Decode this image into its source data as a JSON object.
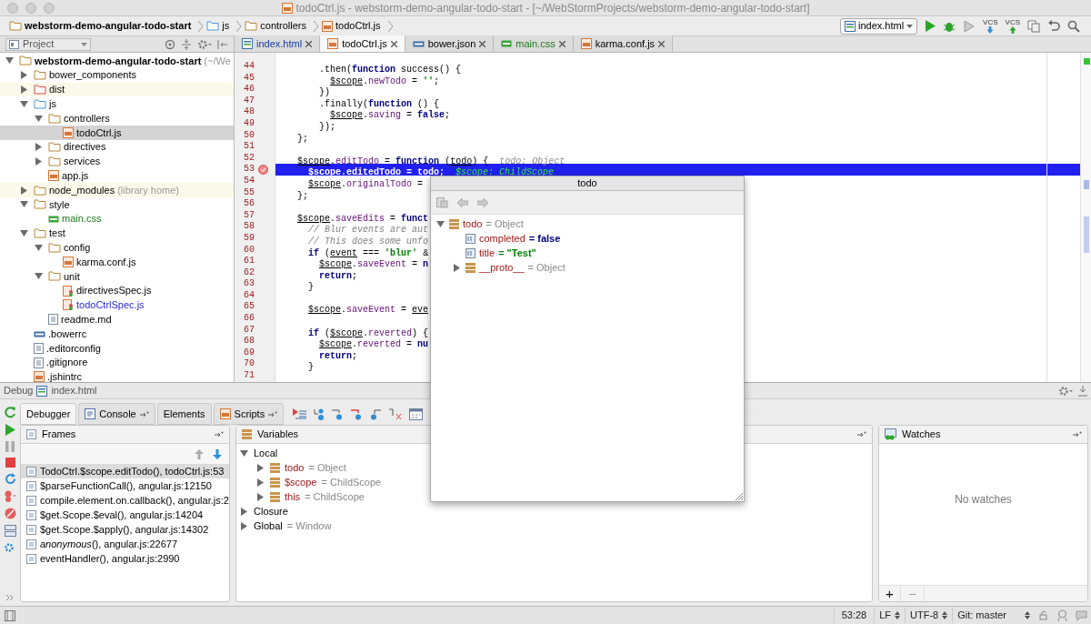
{
  "window": {
    "title": "todoCtrl.js - webstorm-demo-angular-todo-start - [~/WebStormProjects/webstorm-demo-angular-todo-start]"
  },
  "breadcrumbs": [
    {
      "label": "webstorm-demo-angular-todo-start",
      "kind": "folder"
    },
    {
      "label": "js",
      "kind": "source-folder"
    },
    {
      "label": "controllers",
      "kind": "folder"
    },
    {
      "label": "todoCtrl.js",
      "kind": "js"
    }
  ],
  "run_config": {
    "label": "index.html"
  },
  "toolbar": [
    {
      "kind": "run"
    },
    {
      "kind": "debug"
    },
    {
      "kind": "coverage"
    },
    {
      "kind": "vcs-update",
      "label": "VCS"
    },
    {
      "kind": "vcs-commit",
      "label": "VCS"
    },
    {
      "kind": "compare"
    },
    {
      "kind": "undo"
    },
    {
      "kind": "search"
    }
  ],
  "project_panel": {
    "title": "Project"
  },
  "tabs": [
    {
      "label": "index.html",
      "kind": "html",
      "color": "#1a3ca8",
      "selected": false
    },
    {
      "label": "todoCtrl.js",
      "kind": "js",
      "selected": true
    },
    {
      "label": "bower.json",
      "kind": "json",
      "selected": false
    },
    {
      "label": "main.css",
      "kind": "css",
      "color": "#1b7a1b",
      "selected": false
    },
    {
      "label": "karma.conf.js",
      "kind": "js",
      "selected": false
    }
  ],
  "tree": [
    {
      "label": "webstorm-demo-angular-todo-start",
      "note": "(~/We",
      "kind": "folder",
      "expanded": true,
      "children": [
        {
          "label": "bower_components",
          "kind": "folder",
          "expanded": false
        },
        {
          "label": "dist",
          "kind": "excluded-folder",
          "expanded": false,
          "highlighted": true
        },
        {
          "label": "js",
          "kind": "source-folder",
          "expanded": true,
          "children": [
            {
              "label": "controllers",
              "kind": "folder",
              "expanded": true,
              "children": [
                {
                  "label": "todoCtrl.js",
                  "kind": "js",
                  "selected": true
                }
              ]
            },
            {
              "label": "directives",
              "kind": "folder",
              "expanded": false
            },
            {
              "label": "services",
              "kind": "folder",
              "expanded": false
            },
            {
              "label": "app.js",
              "kind": "js",
              "selected": false
            }
          ]
        },
        {
          "label": "node_modules",
          "note": "(library home)",
          "kind": "folder",
          "expanded": false,
          "highlighted": true
        },
        {
          "label": "style",
          "kind": "folder",
          "expanded": true,
          "children": [
            {
              "label": "main.css",
              "kind": "css",
              "color": "#1b7a1b",
              "selected": false
            }
          ]
        },
        {
          "label": "test",
          "kind": "folder",
          "expanded": true,
          "children": [
            {
              "label": "config",
              "kind": "folder",
              "expanded": true,
              "children": [
                {
                  "label": "karma.conf.js",
                  "kind": "js",
                  "selected": false
                }
              ]
            },
            {
              "label": "unit",
              "kind": "folder",
              "expanded": true,
              "children": [
                {
                  "label": "directivesSpec.js",
                  "kind": "test-js",
                  "selected": false
                },
                {
                  "label": "todoCtrlSpec.js",
                  "kind": "test-js",
                  "modified": true,
                  "selected": false
                }
              ]
            },
            {
              "label": "readme.md",
              "kind": "text",
              "selected": false
            }
          ]
        },
        {
          "label": ".bowerrc",
          "kind": "json",
          "selected": false
        },
        {
          "label": ".editorconfig",
          "kind": "text",
          "selected": false
        },
        {
          "label": ".gitignore",
          "kind": "text",
          "selected": false
        },
        {
          "label": ".jshintrc",
          "kind": "js",
          "selected": false
        }
      ]
    }
  ],
  "editor": {
    "lines": [
      {
        "number": "44",
        "tokens": [
          {
            "text": "        .then(",
            "kind": "plain"
          },
          {
            "text": "function",
            "kind": "kw"
          },
          {
            "text": " success() {",
            "kind": "plain"
          }
        ]
      },
      {
        "number": "45",
        "tokens": [
          {
            "text": "          $scope",
            "kind": "var"
          },
          {
            "text": ".",
            "kind": "plain"
          },
          {
            "text": "newTodo",
            "kind": "prop"
          },
          {
            "text": " = ",
            "kind": "plain"
          },
          {
            "text": "''",
            "kind": "str"
          },
          {
            "text": ";",
            "kind": "plain"
          }
        ]
      },
      {
        "number": "46",
        "tokens": [
          {
            "text": "        })",
            "kind": "plain"
          }
        ]
      },
      {
        "number": "47",
        "tokens": [
          {
            "text": "        .finally(",
            "kind": "plain"
          },
          {
            "text": "function",
            "kind": "kw"
          },
          {
            "text": " () {",
            "kind": "plain"
          }
        ]
      },
      {
        "number": "48",
        "tokens": [
          {
            "text": "          $scope",
            "kind": "var"
          },
          {
            "text": ".",
            "kind": "plain"
          },
          {
            "text": "saving",
            "kind": "prop"
          },
          {
            "text": " = ",
            "kind": "plain"
          },
          {
            "text": "false",
            "kind": "kw"
          },
          {
            "text": ";",
            "kind": "plain"
          }
        ]
      },
      {
        "number": "49",
        "tokens": [
          {
            "text": "        });",
            "kind": "plain"
          }
        ]
      },
      {
        "number": "50",
        "tokens": [
          {
            "text": "    };",
            "kind": "plain"
          }
        ]
      },
      {
        "number": "51"
      },
      {
        "number": "52",
        "tokens": [
          {
            "text": "    $scope",
            "kind": "var"
          },
          {
            "text": ".",
            "kind": "plain"
          },
          {
            "text": "editTodo",
            "kind": "prop"
          },
          {
            "text": " = ",
            "kind": "plain"
          },
          {
            "text": "function",
            "kind": "kw"
          },
          {
            "text": " (",
            "kind": "plain"
          },
          {
            "text": "todo",
            "kind": "var"
          },
          {
            "text": ") {",
            "kind": "plain"
          },
          {
            "text": "  todo: Object",
            "kind": "hint"
          }
        ]
      },
      {
        "number": "53",
        "current": true,
        "breakpoint": true,
        "tokens": [
          {
            "text": "      $scope.editedTodo = todo;",
            "kind": "plain"
          },
          {
            "text": "  $scope: ChildScope",
            "kind": "hint"
          }
        ]
      },
      {
        "number": "54",
        "tokens": [
          {
            "text": "      $scope",
            "kind": "var"
          },
          {
            "text": ".",
            "kind": "plain"
          },
          {
            "text": "originalTodo",
            "kind": "prop"
          },
          {
            "text": " =",
            "kind": "plain"
          }
        ]
      },
      {
        "number": "55",
        "tokens": [
          {
            "text": "    };",
            "kind": "plain"
          }
        ]
      },
      {
        "number": "56"
      },
      {
        "number": "57",
        "tokens": [
          {
            "text": "    $scope",
            "kind": "var"
          },
          {
            "text": ".",
            "kind": "plain"
          },
          {
            "text": "saveEdits",
            "kind": "prop"
          },
          {
            "text": " = ",
            "kind": "plain"
          },
          {
            "text": "funct",
            "kind": "kw"
          }
        ]
      },
      {
        "number": "58",
        "tokens": [
          {
            "text": "      // Blur events are aut",
            "kind": "com"
          }
        ]
      },
      {
        "number": "59",
        "tokens": [
          {
            "text": "      // This does some unfo",
            "kind": "com"
          }
        ]
      },
      {
        "number": "60",
        "tokens": [
          {
            "text": "      if",
            "kind": "kw"
          },
          {
            "text": " (",
            "kind": "plain"
          },
          {
            "text": "event",
            "kind": "var"
          },
          {
            "text": " === ",
            "kind": "plain"
          },
          {
            "text": "'blur'",
            "kind": "str"
          },
          {
            "text": " &",
            "kind": "plain"
          }
        ]
      },
      {
        "number": "61",
        "tokens": [
          {
            "text": "        $scope",
            "kind": "var"
          },
          {
            "text": ".",
            "kind": "plain"
          },
          {
            "text": "saveEvent",
            "kind": "prop"
          },
          {
            "text": " = ",
            "kind": "plain"
          },
          {
            "text": "n",
            "kind": "kw"
          }
        ]
      },
      {
        "number": "62",
        "tokens": [
          {
            "text": "        return",
            "kind": "kw"
          },
          {
            "text": ";",
            "kind": "plain"
          }
        ]
      },
      {
        "number": "63",
        "tokens": [
          {
            "text": "      }",
            "kind": "plain"
          }
        ]
      },
      {
        "number": "64"
      },
      {
        "number": "65",
        "tokens": [
          {
            "text": "      $scope",
            "kind": "var"
          },
          {
            "text": ".",
            "kind": "plain"
          },
          {
            "text": "saveEvent",
            "kind": "prop"
          },
          {
            "text": " = ",
            "kind": "plain"
          },
          {
            "text": "eve",
            "kind": "var"
          }
        ]
      },
      {
        "number": "66"
      },
      {
        "number": "67",
        "tokens": [
          {
            "text": "      if",
            "kind": "kw"
          },
          {
            "text": " (",
            "kind": "plain"
          },
          {
            "text": "$scope",
            "kind": "var"
          },
          {
            "text": ".",
            "kind": "plain"
          },
          {
            "text": "reverted",
            "kind": "prop"
          },
          {
            "text": ") {",
            "kind": "plain"
          }
        ]
      },
      {
        "number": "68",
        "tokens": [
          {
            "text": "        $scope",
            "kind": "var"
          },
          {
            "text": ".",
            "kind": "plain"
          },
          {
            "text": "reverted",
            "kind": "prop"
          },
          {
            "text": " = ",
            "kind": "plain"
          },
          {
            "text": "nu",
            "kind": "kw"
          }
        ]
      },
      {
        "number": "69",
        "tokens": [
          {
            "text": "        return",
            "kind": "kw"
          },
          {
            "text": ";",
            "kind": "plain"
          }
        ]
      },
      {
        "number": "70",
        "tokens": [
          {
            "text": "      }",
            "kind": "plain"
          }
        ]
      },
      {
        "number": "71"
      }
    ]
  },
  "popup": {
    "title": "todo",
    "tree": [
      {
        "name": "todo",
        "value": "= Object",
        "kind": "object",
        "expanded": true,
        "children": [
          {
            "name": "completed",
            "value": "= false",
            "kind": "boolean"
          },
          {
            "name": "title",
            "value": "= \"Test\"",
            "kind": "string"
          },
          {
            "name": "__proto__",
            "value": "= Object",
            "kind": "object",
            "expanded": false
          }
        ]
      }
    ]
  },
  "debug": {
    "label": "Debug",
    "config": "index.html",
    "tabs": [
      {
        "label": "Debugger",
        "kind": "debugger",
        "selected": true
      },
      {
        "label": "Console",
        "kind": "console",
        "selected": false
      },
      {
        "label": "Elements",
        "kind": "elements",
        "selected": false
      },
      {
        "label": "Scripts",
        "kind": "scripts",
        "selected": false
      }
    ],
    "frames": {
      "title": "Frames",
      "items": [
        {
          "text": "TodoCtrl.$scope.editTodo(), todoCtrl.js:53",
          "selected": true
        },
        {
          "text": "$parseFunctionCall(), angular.js:12150",
          "selected": false
        },
        {
          "text": "compile.element.on.callback(), angular.js:2",
          "selected": false
        },
        {
          "text": "$get.Scope.$eval(), angular.js:14204",
          "selected": false
        },
        {
          "text": "$get.Scope.$apply(), angular.js:14302",
          "selected": false
        },
        {
          "text": "*anonymous*(), angular.js:22677",
          "selected": false
        },
        {
          "text": "eventHandler(), angular.js:2990",
          "selected": false
        }
      ]
    },
    "variables": {
      "title": "Variables",
      "tree": [
        {
          "name": "Local",
          "expanded": true,
          "children": [
            {
              "name": "todo",
              "value": "= Object",
              "expanded": false
            },
            {
              "name": "$scope",
              "value": "= ChildScope",
              "expanded": false
            },
            {
              "name": "this",
              "value": "= ChildScope",
              "expanded": false
            }
          ]
        },
        {
          "name": "Closure",
          "expanded": false
        },
        {
          "name": "Global",
          "value": "= Window",
          "expanded": false
        }
      ]
    },
    "watches": {
      "title": "Watches",
      "empty_text": "No watches",
      "add": "+",
      "remove": "−"
    }
  },
  "status_bar": {
    "position": "53:28",
    "line_separator": "LF",
    "encoding": "UTF-8",
    "vcs": "Git: master"
  }
}
